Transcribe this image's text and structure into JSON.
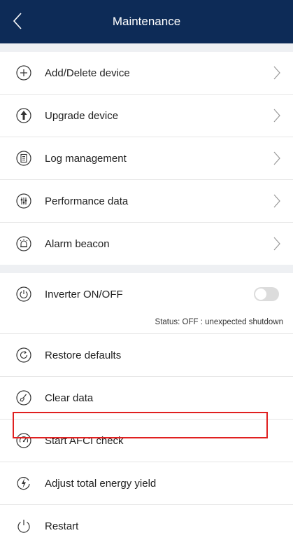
{
  "header": {
    "title": "Maintenance"
  },
  "menu_group_1": [
    {
      "label": "Add/Delete device",
      "icon": "plus-circle-icon"
    },
    {
      "label": "Upgrade device",
      "icon": "upload-arrow-icon"
    },
    {
      "label": "Log management",
      "icon": "log-document-icon"
    },
    {
      "label": "Performance data",
      "icon": "sliders-icon"
    },
    {
      "label": "Alarm beacon",
      "icon": "alarm-beacon-icon"
    }
  ],
  "inverter": {
    "label": "Inverter ON/OFF",
    "icon": "power-icon",
    "toggle_state": "off",
    "status": "Status: OFF : unexpected shutdown"
  },
  "menu_group_2": [
    {
      "label": "Restore defaults",
      "icon": "restore-icon"
    },
    {
      "label": "Clear data",
      "icon": "clear-data-icon"
    },
    {
      "label": "Start AFCI check",
      "icon": "afci-check-icon",
      "highlighted": true
    },
    {
      "label": "Adjust total energy yield",
      "icon": "energy-yield-icon"
    },
    {
      "label": "Restart",
      "icon": "restart-icon"
    }
  ],
  "colors": {
    "header": "#0d2b57",
    "highlight": "#e02020",
    "band": "#eef0f3"
  }
}
